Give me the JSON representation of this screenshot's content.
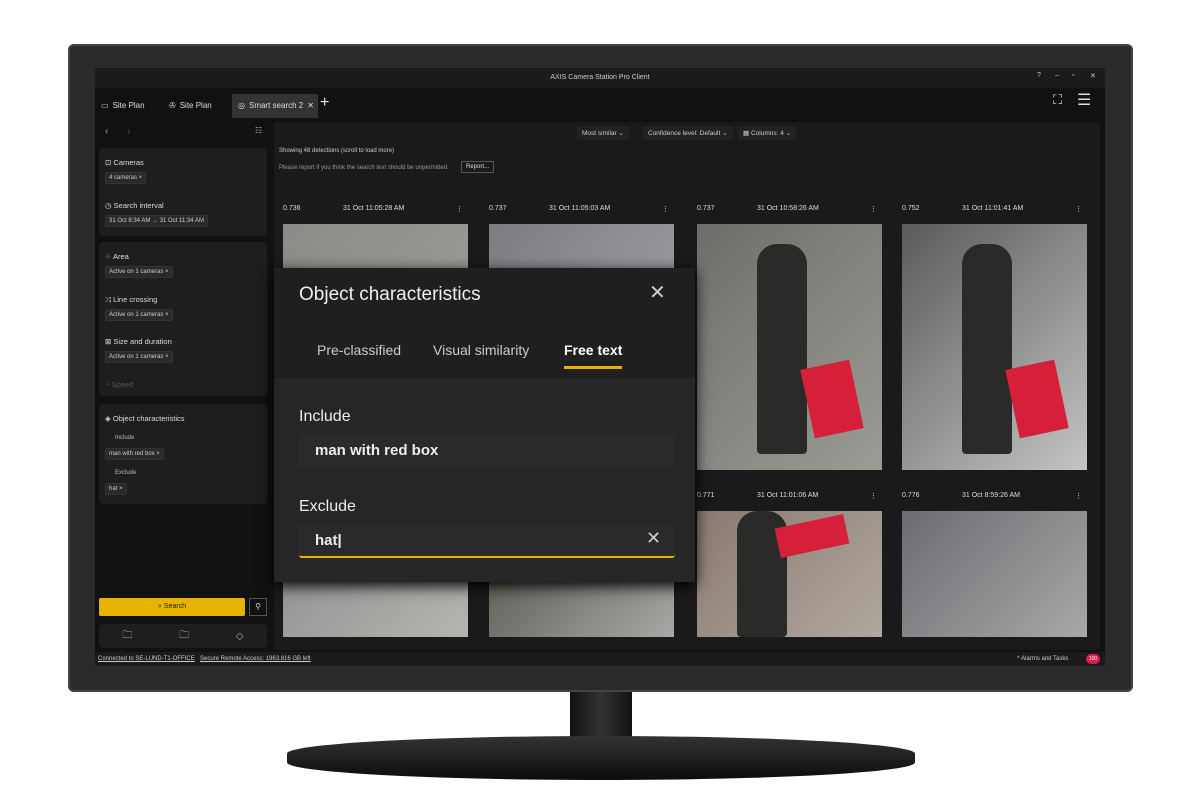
{
  "window": {
    "title": "AXIS Camera Station Pro Client",
    "controls": [
      "?",
      "–",
      "▫",
      "✕"
    ]
  },
  "tabs": [
    {
      "label": "Site Plan",
      "icon": "monitor-icon"
    },
    {
      "label": "Site Plan",
      "icon": "film-reel-icon"
    },
    {
      "label": "Smart search 2",
      "icon": "smart-search-icon",
      "active": true
    }
  ],
  "sidebar": {
    "cameras": {
      "label": "Cameras",
      "chip": "4 cameras"
    },
    "interval": {
      "label": "Search interval",
      "chip": "31 Oct 8:34 AM → 31 Oct 11:34 AM"
    },
    "filters": [
      {
        "label": "Area",
        "chip": "Active on 1 cameras"
      },
      {
        "label": "Line crossing",
        "chip": "Active on 1 cameras"
      },
      {
        "label": "Size and duration",
        "chip": "Active on 1 cameras"
      }
    ],
    "speed": "Speed",
    "object": {
      "label": "Object characteristics",
      "include_label": "Include",
      "include_chip": "man with red box",
      "exclude_label": "Exclude",
      "exclude_chip": "hat"
    },
    "search_button": "Search"
  },
  "toolbar": {
    "sort": "Most similar",
    "confidence": "Confidence level: Default",
    "columns": "Columns: 4"
  },
  "results": {
    "summary": "Showing 48 detections (scroll to load more)",
    "report_text": "Please report if you think the search text should be unpermitted.",
    "report_button": "Report...",
    "cards": [
      {
        "score": "0.736",
        "time": "31 Oct 11:05:28 AM"
      },
      {
        "score": "0.737",
        "time": "31 Oct 11:05:03 AM"
      },
      {
        "score": "0.737",
        "time": "31 Oct 10:58:26 AM"
      },
      {
        "score": "0.752",
        "time": "31 Oct 11:01:41 AM"
      },
      {
        "score": "0.771",
        "time": "31 Oct 11:01:06 AM"
      },
      {
        "score": "0.776",
        "time": "31 Oct 8:59:26 AM"
      }
    ]
  },
  "dialog": {
    "title": "Object characteristics",
    "tabs": [
      "Pre-classified",
      "Visual similarity",
      "Free text"
    ],
    "active_tab": "Free text",
    "include_label": "Include",
    "include_value": "man with red box",
    "exclude_label": "Exclude",
    "exclude_value": "hat"
  },
  "status": {
    "connection": "Connected to SE-LUND-T1-OFFICE",
    "remote": "Secure Remote Access: 1963.816 GB left",
    "alarms": "Alarms and Tasks",
    "badge": "100"
  },
  "colors": {
    "accent": "#e8b200",
    "badge": "#d6204a"
  }
}
